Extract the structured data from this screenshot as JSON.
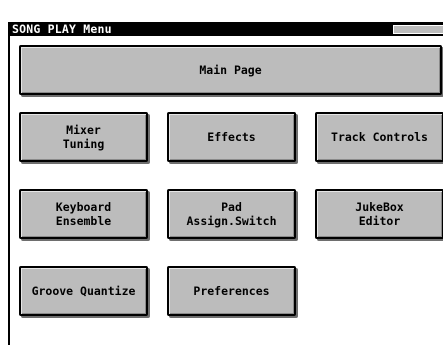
{
  "menu": {
    "title": "SONG PLAY Menu"
  },
  "buttons": {
    "main_page": "Main Page",
    "mixer_tuning": "Mixer\nTuning",
    "effects": "Effects",
    "track_controls": "Track Controls",
    "keyboard_ensemble": "Keyboard\nEnsemble",
    "pad_assign_switch": "Pad\nAssign.Switch",
    "jukebox_editor": "JukeBox\nEditor",
    "groove_quantize": "Groove Quantize",
    "preferences": "Preferences"
  },
  "colors": {
    "titlebar": "#000000",
    "button_face": "#bcbcbc",
    "background": "#ffffff"
  }
}
